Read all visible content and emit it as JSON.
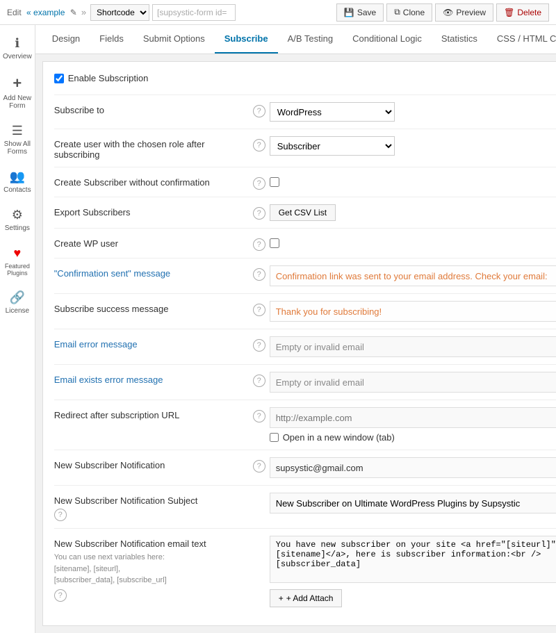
{
  "topbar": {
    "edit_label": "Edit",
    "example_label": "« example",
    "edit_icon": "✎",
    "arrow": "»",
    "shortcode_label": "Shortcode",
    "shortcode_dropdown": "Shortcode ▼",
    "shortcode_value": "[supsystic-form id=",
    "save_label": "Save",
    "clone_label": "Clone",
    "preview_label": "Preview",
    "delete_label": "Delete"
  },
  "sidebar": {
    "items": [
      {
        "id": "overview",
        "icon": "ℹ",
        "label": "Overview"
      },
      {
        "id": "add-new-form",
        "icon": "＋",
        "label": "Add New Form"
      },
      {
        "id": "show-all-forms",
        "icon": "☰",
        "label": "Show All Forms"
      },
      {
        "id": "contacts",
        "icon": "👥",
        "label": "Contacts"
      },
      {
        "id": "settings",
        "icon": "⚙",
        "label": "Settings"
      },
      {
        "id": "featured-plugins",
        "icon": "♥",
        "label": "Featured Plugins"
      },
      {
        "id": "license",
        "icon": "🔗",
        "label": "License"
      }
    ]
  },
  "tabs": [
    {
      "id": "design",
      "label": "Design"
    },
    {
      "id": "fields",
      "label": "Fields"
    },
    {
      "id": "submit-options",
      "label": "Submit Options"
    },
    {
      "id": "subscribe",
      "label": "Subscribe",
      "active": true
    },
    {
      "id": "ab-testing",
      "label": "A/B Testing"
    },
    {
      "id": "conditional-logic",
      "label": "Conditional Logic"
    },
    {
      "id": "statistics",
      "label": "Statistics"
    },
    {
      "id": "css-html-code",
      "label": "CSS / HTML Code"
    }
  ],
  "content": {
    "enable_subscription_label": "Enable Subscription",
    "rows": [
      {
        "id": "subscribe-to",
        "label": "Subscribe to",
        "blue": false,
        "type": "select",
        "value": "WordPress",
        "options": [
          "WordPress"
        ]
      },
      {
        "id": "create-user-role",
        "label": "Create user with the chosen role after subscribing",
        "blue": false,
        "type": "select",
        "value": "Subscriber",
        "options": [
          "Subscriber"
        ]
      },
      {
        "id": "create-without-confirmation",
        "label": "Create Subscriber without confirmation",
        "blue": false,
        "type": "checkbox",
        "checked": false
      },
      {
        "id": "export-subscribers",
        "label": "Export Subscribers",
        "blue": false,
        "type": "button",
        "button_label": "Get CSV List"
      },
      {
        "id": "create-wp-user",
        "label": "Create WP user",
        "blue": false,
        "type": "checkbox",
        "checked": false
      },
      {
        "id": "confirmation-message",
        "label": "\"Confirmation sent\" message",
        "blue": true,
        "type": "text",
        "value": "Confirmation link was sent to your email address. Check your email:",
        "color": "orange"
      },
      {
        "id": "subscribe-success-message",
        "label": "Subscribe success message",
        "blue": false,
        "type": "text",
        "value": "Thank you for subscribing!",
        "color": "orange"
      },
      {
        "id": "email-error-message",
        "label": "Email error message",
        "blue": true,
        "type": "text",
        "value": "Empty or invalid email",
        "color": "normal"
      },
      {
        "id": "email-exists-error-message",
        "label": "Email exists error message",
        "blue": true,
        "type": "text",
        "value": "Empty or invalid email",
        "color": "normal"
      },
      {
        "id": "redirect-url",
        "label": "Redirect after subscription URL",
        "blue": false,
        "type": "redirect",
        "placeholder": "http://example.com",
        "open_new_window_label": "Open in a new window (tab)"
      },
      {
        "id": "new-subscriber-notification",
        "label": "New Subscriber Notification",
        "blue": false,
        "type": "text",
        "value": "supsystic@gmail.com",
        "color": "normal-dark"
      },
      {
        "id": "notification-subject",
        "label": "New Subscriber Notification Subject",
        "blue": false,
        "type": "text",
        "value": "New Subscriber on Ultimate WordPress Plugins by Supsystic",
        "color": "normal-dark"
      },
      {
        "id": "notification-email-text",
        "label": "New Subscriber Notification email text",
        "blue": false,
        "type": "textarea",
        "value": "You have new subscriber on your site <a href=\"[siteurl]\">[sitename]</a>, here is subscriber information:<br />[subscriber_data]",
        "variables_hint": "You can use next variables here:\n[sitename], [siteurl],\n[subscriber_data], [subscribe_url]"
      }
    ],
    "add_attach_label": "+ Add Attach"
  }
}
